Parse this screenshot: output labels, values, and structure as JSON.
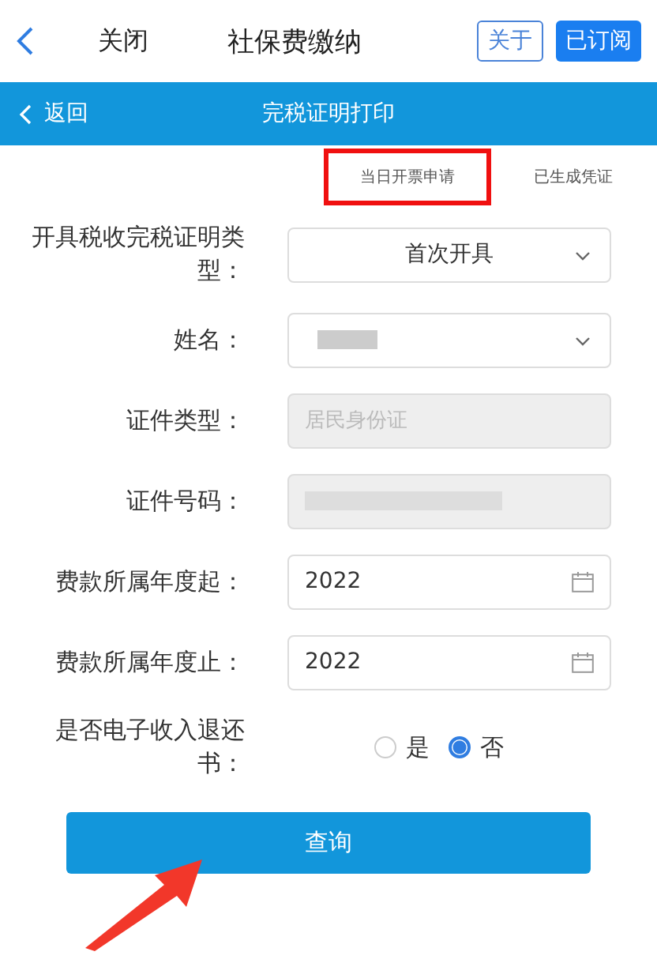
{
  "header": {
    "close": "关闭",
    "title": "社保费缴纳",
    "about": "关于",
    "subscribed": "已订阅"
  },
  "subbar": {
    "back": "返回",
    "title": "完税证明打印"
  },
  "tabs": [
    {
      "label": "当日开票申请",
      "annotated": true
    },
    {
      "label": "已生成凭证",
      "annotated": false
    }
  ],
  "form": [
    {
      "kind": "select",
      "label": "开具税收完税证明类型：",
      "value": "首次开具"
    },
    {
      "kind": "select",
      "label": "姓名：",
      "blurred": true
    },
    {
      "kind": "readonly",
      "label": "证件类型：",
      "placeholder": "居民身份证"
    },
    {
      "kind": "readonly",
      "label": "证件号码：",
      "blurred": true
    },
    {
      "kind": "date",
      "label": "费款所属年度起：",
      "value": "2022"
    },
    {
      "kind": "date",
      "label": "费款所属年度止：",
      "value": "2022"
    },
    {
      "kind": "radio",
      "label": "是否电子收入退还书：",
      "options": [
        {
          "label": "是",
          "selected": false
        },
        {
          "label": "否",
          "selected": true
        }
      ]
    }
  ],
  "query_button": "查询",
  "arrow_annotation": true
}
